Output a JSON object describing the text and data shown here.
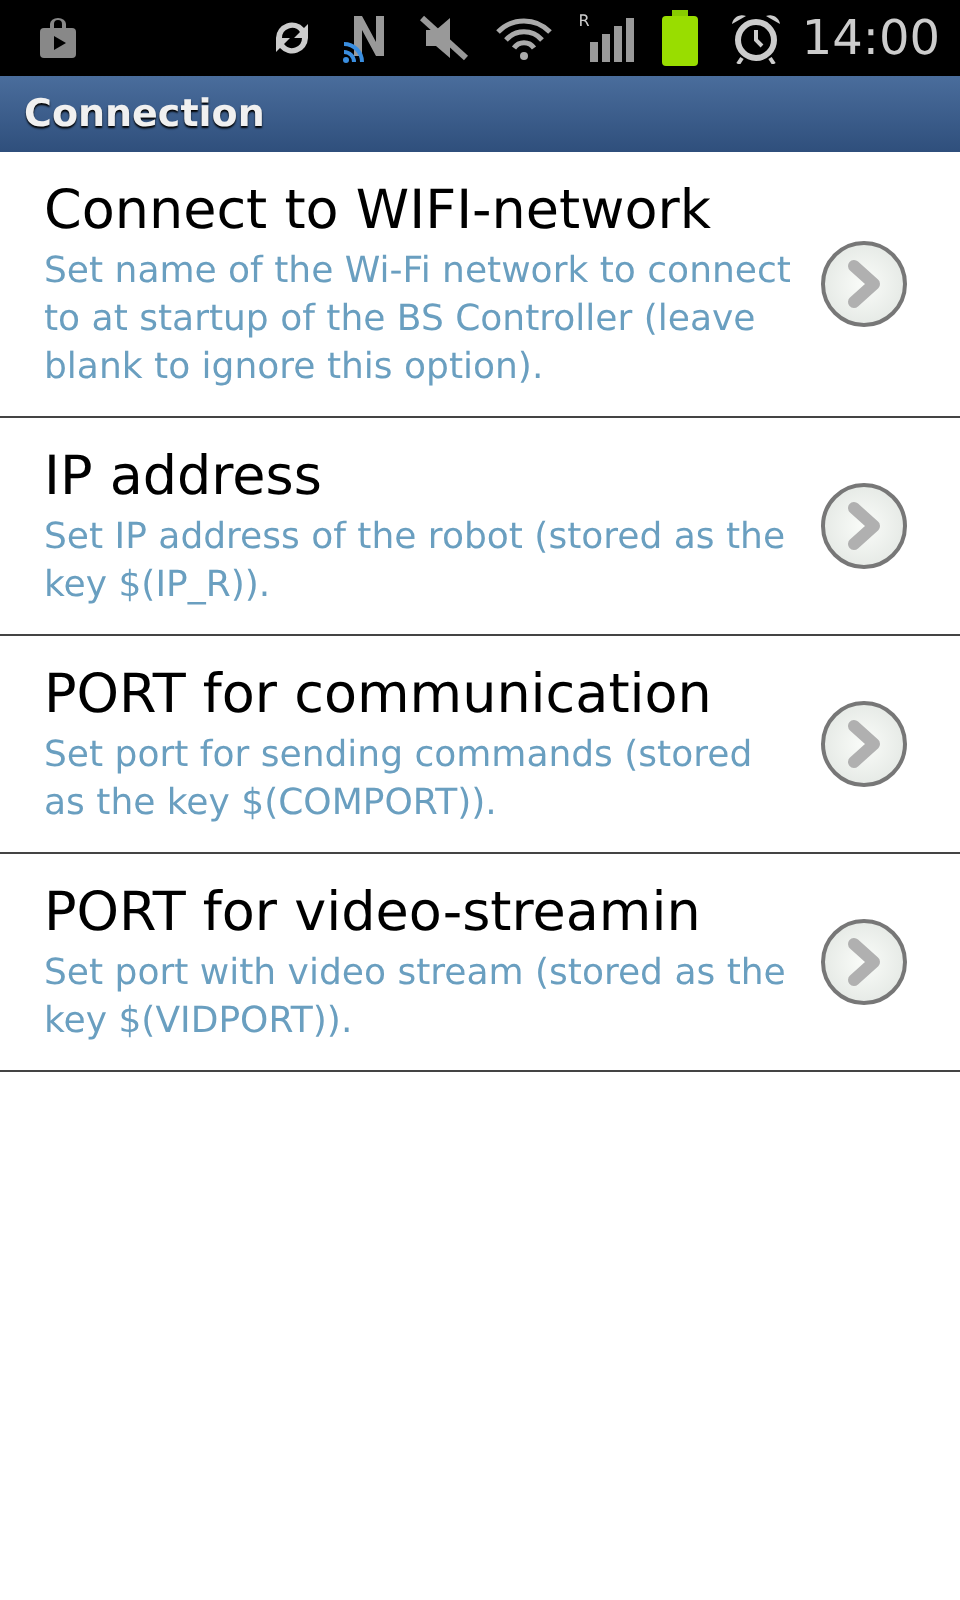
{
  "status_bar": {
    "roaming": "R",
    "time": "14:00"
  },
  "title_bar": {
    "title": "Connection"
  },
  "preferences": [
    {
      "title": "Connect to WIFI-network",
      "summary": "Set name of the Wi-Fi network to connect to at startup of the BS Controller (leave blank to ignore this option)."
    },
    {
      "title": "IP address",
      "summary": "Set IP address of the robot (stored as the key $(IP_R))."
    },
    {
      "title": "PORT for communication",
      "summary": "Set port for sending commands (stored as the key $(COMPORT))."
    },
    {
      "title": "PORT for video-streamin",
      "summary": "Set port with video stream (stored as the key $(VIDPORT))."
    }
  ]
}
